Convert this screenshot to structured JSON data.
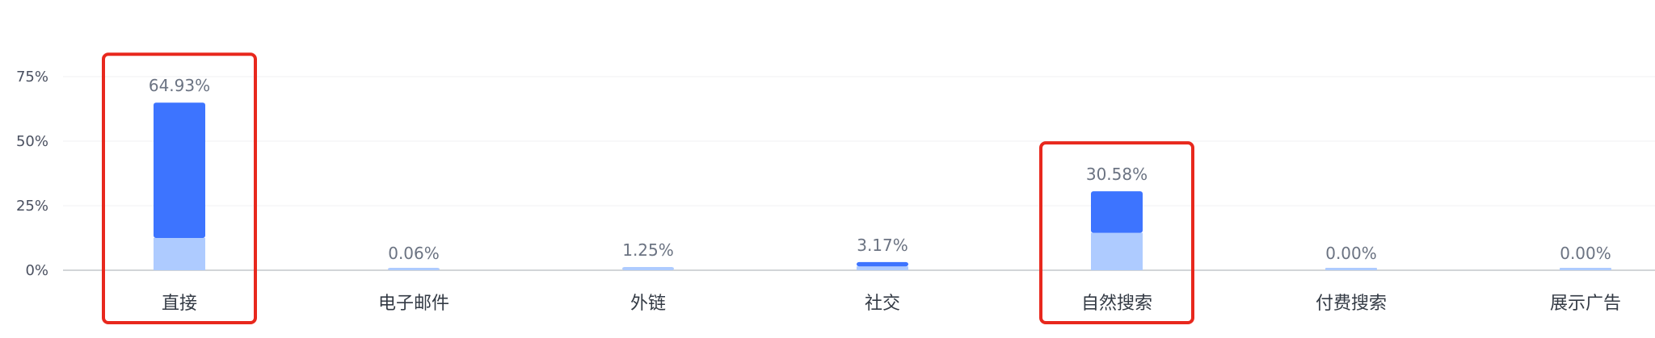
{
  "chart_data": {
    "type": "bar",
    "stacked": true,
    "categories": [
      "直接",
      "电子邮件",
      "外链",
      "社交",
      "自然搜索",
      "付费搜索",
      "展示广告"
    ],
    "totals": [
      64.93,
      0.06,
      1.25,
      3.17,
      30.58,
      0.0,
      0.0
    ],
    "value_labels": [
      "64.93%",
      "0.06%",
      "1.25%",
      "3.17%",
      "30.58%",
      "0.00%",
      "0.00%"
    ],
    "series": [
      {
        "values": [
          12.5,
          0.06,
          1.25,
          1.5,
          14.5,
          0.0,
          0.0
        ]
      },
      {
        "values": [
          52.43,
          0.0,
          0.0,
          1.67,
          16.08,
          0.0,
          0.0
        ]
      }
    ],
    "colors": [
      "#aecbff",
      "#3d74ff"
    ],
    "yticks": [
      "0%",
      "25%",
      "50%",
      "75%"
    ],
    "ytick_values": [
      0,
      25,
      50,
      75
    ],
    "ylim": [
      0,
      75
    ],
    "grid": true,
    "highlighted_categories": [
      "直接",
      "自然搜索"
    ],
    "highlight_color": "#e8281d"
  }
}
